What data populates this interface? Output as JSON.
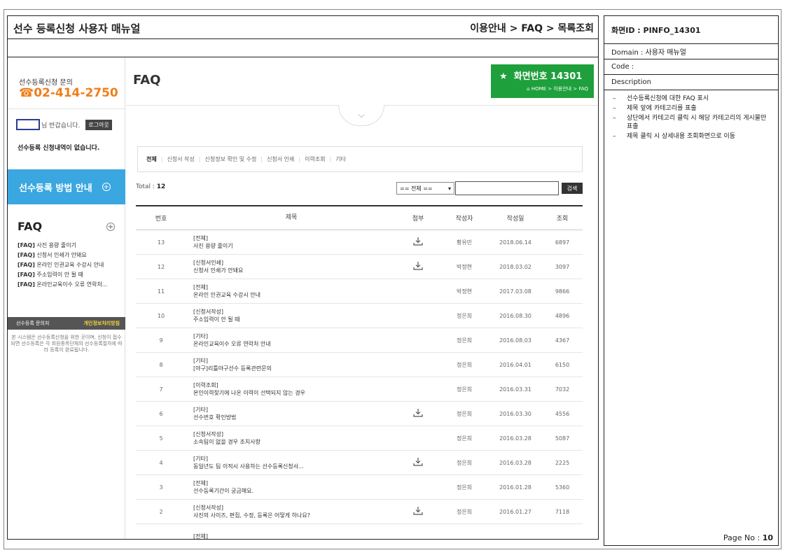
{
  "doc": {
    "title": "선수 등록신청 사용자 매뉴얼",
    "path": "이용안내 > FAQ > 목록조회"
  },
  "spec": {
    "screen_id": "화면ID : PINFO_14301",
    "domain": "Domain : 사용자 매뉴얼",
    "code": "Code :",
    "description_label": "Description",
    "descriptions": [
      "선수등록신청에 대한 FAQ 표시",
      "제목 앞에 카테고리를 표출",
      "상단에서 카테고리 클릭 시 해당 카테고리의 게시물만 표출",
      "제목 클릭 시 상세내용 조회화면으로 이동"
    ],
    "page_no_label": "Page No :",
    "page_no": "10"
  },
  "sidebar": {
    "contact_label": "선수등록신청 문의",
    "contact_phone": "02-414-2750",
    "greeting": "님 반갑습니다.",
    "logout_label": "로그아웃",
    "no_history": "선수등록 신청내역이 없습니다.",
    "guide_label": "선수등록 방법 안내",
    "faq_heading": "FAQ",
    "faq_items": [
      {
        "tag": "[FAQ]",
        "text": "사진 용량 줄이기"
      },
      {
        "tag": "[FAQ]",
        "text": "신청서 인쇄가 안돼요"
      },
      {
        "tag": "[FAQ]",
        "text": "온라인 인권교육 수강시 안내"
      },
      {
        "tag": "[FAQ]",
        "text": "주소입력이 안 될 때"
      },
      {
        "tag": "[FAQ]",
        "text": "온라인교육이수 오류 연락처..."
      }
    ],
    "footer_left": "선수등록 문의처",
    "footer_right": "개인정보처리방침",
    "note": "본 시스템은 선수등록신청을 위한 곳이며, 신청이 접수되면 선수등록은 각 회원종목단체의 선수등록절차에 따라 등록이 완료됩니다."
  },
  "main": {
    "title": "FAQ",
    "badge_title": "화면번호 14301",
    "badge_crumb": "HOME > 이용안내 > FAQ",
    "categories": [
      "전체",
      "신청서 작성",
      "신청정보 확인 및 수정",
      "신청서 인쇄",
      "이력조회",
      "기타"
    ],
    "total_label": "Total :",
    "total_count": "12",
    "filter_value": "== 전체 ==",
    "search_label": "검색",
    "columns": [
      "번호",
      "제목",
      "첨부",
      "작성자",
      "작성일",
      "조회"
    ],
    "rows": [
      {
        "no": "13",
        "cat": "[전체]",
        "title": "사진 용량 줄이기",
        "attach": true,
        "writer": "황유민",
        "date": "2018.06.14",
        "views": "6897"
      },
      {
        "no": "12",
        "cat": "[신청서인쇄]",
        "title": "신청서 인쇄가 안돼요",
        "attach": true,
        "writer": "박정현",
        "date": "2018.03.02",
        "views": "3097"
      },
      {
        "no": "11",
        "cat": "[전체]",
        "title": "온라인 인권교육 수강시 안내",
        "attach": false,
        "writer": "박정현",
        "date": "2017.03.08",
        "views": "9866"
      },
      {
        "no": "10",
        "cat": "[신청서작성]",
        "title": "주소입력이 안 될 때",
        "attach": false,
        "writer": "정은희",
        "date": "2016.08.30",
        "views": "4896"
      },
      {
        "no": "9",
        "cat": "[기타]",
        "title": "온라인교육이수 오류 연락처 안내",
        "attach": false,
        "writer": "정은희",
        "date": "2016.08.03",
        "views": "4367"
      },
      {
        "no": "8",
        "cat": "[기타]",
        "title": "[야구]리틀야구선수 등록관련문의",
        "attach": false,
        "writer": "정은희",
        "date": "2016.04.01",
        "views": "6150"
      },
      {
        "no": "7",
        "cat": "[이력조회]",
        "title": "본인이력찾기에 나온 이력이 선택되지 않는 경우",
        "attach": false,
        "writer": "정은희",
        "date": "2016.03.31",
        "views": "7032"
      },
      {
        "no": "6",
        "cat": "[기타]",
        "title": "선수번호 확인방법",
        "attach": true,
        "writer": "정은희",
        "date": "2016.03.30",
        "views": "4556"
      },
      {
        "no": "5",
        "cat": "[신청서작성]",
        "title": "소속팀이 없을 경우 조치사항",
        "attach": false,
        "writer": "정은희",
        "date": "2016.03.28",
        "views": "5087"
      },
      {
        "no": "4",
        "cat": "[기타]",
        "title": "동일년도 팀 이적시 사용하는 선수등록신청서...",
        "attach": true,
        "writer": "정은희",
        "date": "2016.03.28",
        "views": "2225"
      },
      {
        "no": "3",
        "cat": "[전체]",
        "title": "선수등록기간이 궁금해요.",
        "attach": false,
        "writer": "정은희",
        "date": "2016.01.28",
        "views": "5360"
      },
      {
        "no": "2",
        "cat": "[신청서작성]",
        "title": "사진의 사이즈, 편집, 수정, 등록은 어떻게 하나요?",
        "attach": true,
        "writer": "정은희",
        "date": "2016.01.27",
        "views": "7118"
      },
      {
        "no": "",
        "cat": "[전체]",
        "title": "",
        "attach": false,
        "writer": "",
        "date": "",
        "views": ""
      }
    ]
  }
}
